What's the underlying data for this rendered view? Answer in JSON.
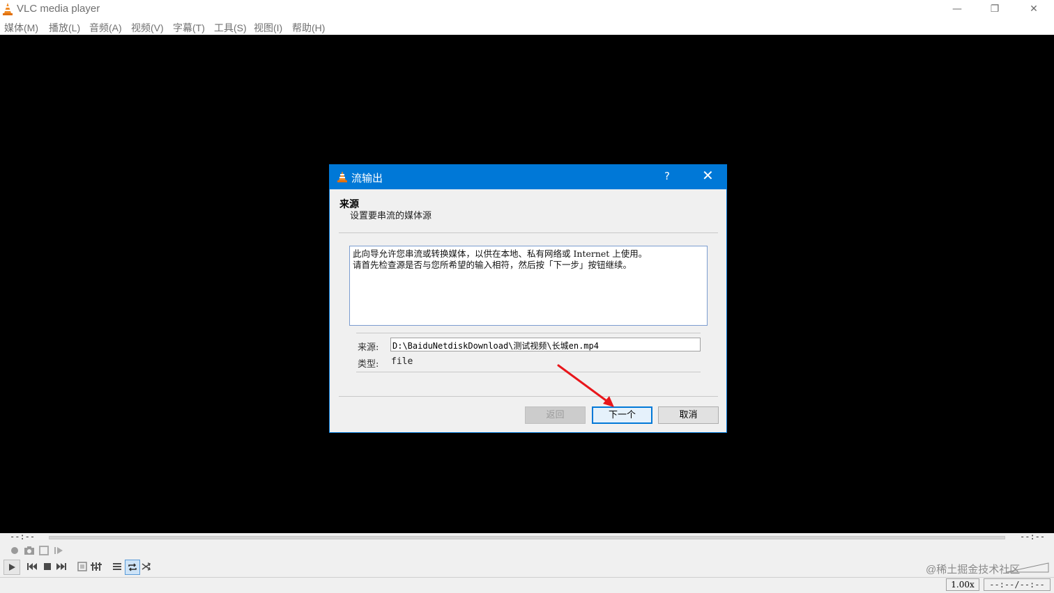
{
  "window": {
    "title": "VLC media player",
    "minimize_glyph": "—",
    "restore_glyph": "❐",
    "close_glyph": "✕"
  },
  "menu": [
    {
      "label": "媒体(M)"
    },
    {
      "label": "播放(L)"
    },
    {
      "label": "音频(A)"
    },
    {
      "label": "视频(V)"
    },
    {
      "label": "字幕(T)"
    },
    {
      "label": "工具(S)"
    },
    {
      "label": "视图(I)"
    },
    {
      "label": "帮助(H)"
    }
  ],
  "dialog": {
    "title": "流输出",
    "help_glyph": "?",
    "close_glyph": "✕",
    "section_title": "来源",
    "section_subtitle": "设置要串流的媒体源",
    "description_line1": "此向导允许您串流或转换媒体，以供在本地、私有网络或 Internet 上使用。",
    "description_line2": "请首先检查源是否与您所希望的输入相符，然后按「下一步」按钮继续。",
    "source_label": "来源:",
    "source_value": "D:\\BaiduNetdiskDownload\\测试视频\\长城en.mp4",
    "type_label": "类型:",
    "type_value": "file",
    "back_button": "返回",
    "next_button": "下一个",
    "cancel_button": "取消"
  },
  "player": {
    "elapsed": "--:--",
    "remaining": "--:--",
    "speed": "1.00x",
    "status_time": "--:--/--:--"
  },
  "watermark": "@稀土掘金技术社区",
  "colors": {
    "accent": "#0078d7",
    "annotation_arrow": "#e8161b"
  }
}
